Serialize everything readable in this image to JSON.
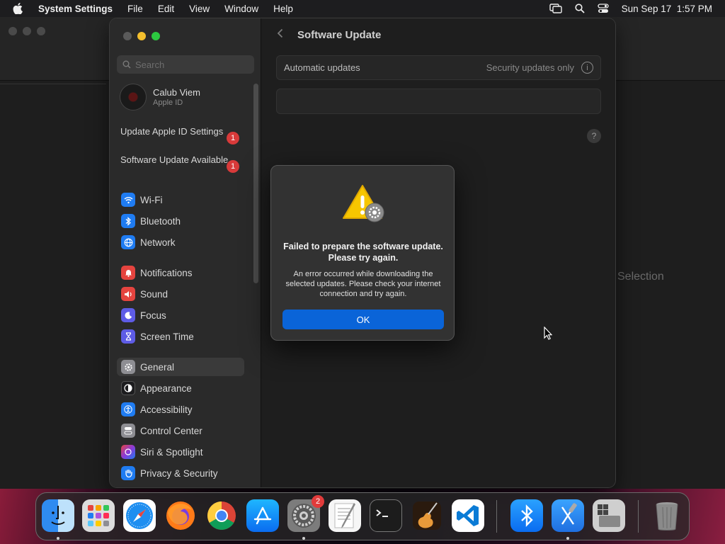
{
  "menubar": {
    "app_name": "System Settings",
    "items": [
      "File",
      "Edit",
      "View",
      "Window",
      "Help"
    ],
    "datetime": "Sun Sep 17  1:57 PM"
  },
  "background_window": {
    "partial_text": "Selection"
  },
  "sidebar": {
    "search_placeholder": "Search",
    "profile": {
      "name": "Calub Viem",
      "subtitle": "Apple ID"
    },
    "notices": [
      {
        "label": "Update Apple ID Settings",
        "badge": "1"
      },
      {
        "label": "Software Update Available",
        "badge": "1"
      }
    ],
    "items": [
      {
        "label": "Wi-Fi",
        "icon": "wifi-icon",
        "color": "#1f7cf2"
      },
      {
        "label": "Bluetooth",
        "icon": "bluetooth-icon",
        "color": "#1f7cf2"
      },
      {
        "label": "Network",
        "icon": "globe-icon",
        "color": "#1f7cf2"
      },
      {
        "label": "Notifications",
        "icon": "bell-icon",
        "color": "#e5443f"
      },
      {
        "label": "Sound",
        "icon": "speaker-icon",
        "color": "#e5443f"
      },
      {
        "label": "Focus",
        "icon": "moon-icon",
        "color": "#5e5ce6"
      },
      {
        "label": "Screen Time",
        "icon": "hourglass-icon",
        "color": "#5e5ce6"
      },
      {
        "label": "General",
        "icon": "gear-icon",
        "color": "#8e8e93",
        "selected": true
      },
      {
        "label": "Appearance",
        "icon": "appearance-icon",
        "color": "#1c1c1e"
      },
      {
        "label": "Accessibility",
        "icon": "accessibility-icon",
        "color": "#1f7cf2"
      },
      {
        "label": "Control Center",
        "icon": "control-center-icon",
        "color": "#8e8e93"
      },
      {
        "label": "Siri & Spotlight",
        "icon": "siri-icon",
        "color": "#c0367a"
      },
      {
        "label": "Privacy & Security",
        "icon": "hand-icon",
        "color": "#1f7cf2"
      }
    ]
  },
  "content": {
    "title": "Software Update",
    "automatic_updates_label": "Automatic updates",
    "automatic_updates_value": "Security updates only",
    "help_label": "?"
  },
  "dialog": {
    "headline": "Failed to prepare the software update. Please try again.",
    "body": "An error occurred while downloading the selected updates. Please check your internet connection and try again.",
    "ok_label": "OK"
  },
  "dock": {
    "apps": [
      {
        "name": "Finder",
        "icon": "finder-icon",
        "running": true
      },
      {
        "name": "Launchpad",
        "icon": "launchpad-icon",
        "running": false
      },
      {
        "name": "Safari",
        "icon": "safari-icon",
        "running": false
      },
      {
        "name": "Firefox",
        "icon": "firefox-icon",
        "running": false
      },
      {
        "name": "Chrome",
        "icon": "chrome-icon",
        "running": false
      },
      {
        "name": "App Store",
        "icon": "app-store-icon",
        "running": false
      },
      {
        "name": "System Settings",
        "icon": "system-settings-icon",
        "running": true,
        "badge": "2"
      },
      {
        "name": "TextEdit",
        "icon": "textedit-icon",
        "running": false
      },
      {
        "name": "Terminal",
        "icon": "terminal-icon",
        "running": false
      },
      {
        "name": "GarageBand",
        "icon": "garageband-icon",
        "running": false
      },
      {
        "name": "VS Code",
        "icon": "vscode-icon",
        "running": false
      },
      {
        "name": "Bluetooth File Exchange",
        "icon": "bluetooth-icon",
        "running": false
      },
      {
        "name": "Xcode",
        "icon": "xcode-icon",
        "running": true
      },
      {
        "name": "Boot Camp Assistant",
        "icon": "bootcamp-icon",
        "running": false
      },
      {
        "name": "Trash",
        "icon": "trash-icon",
        "running": false
      }
    ]
  }
}
